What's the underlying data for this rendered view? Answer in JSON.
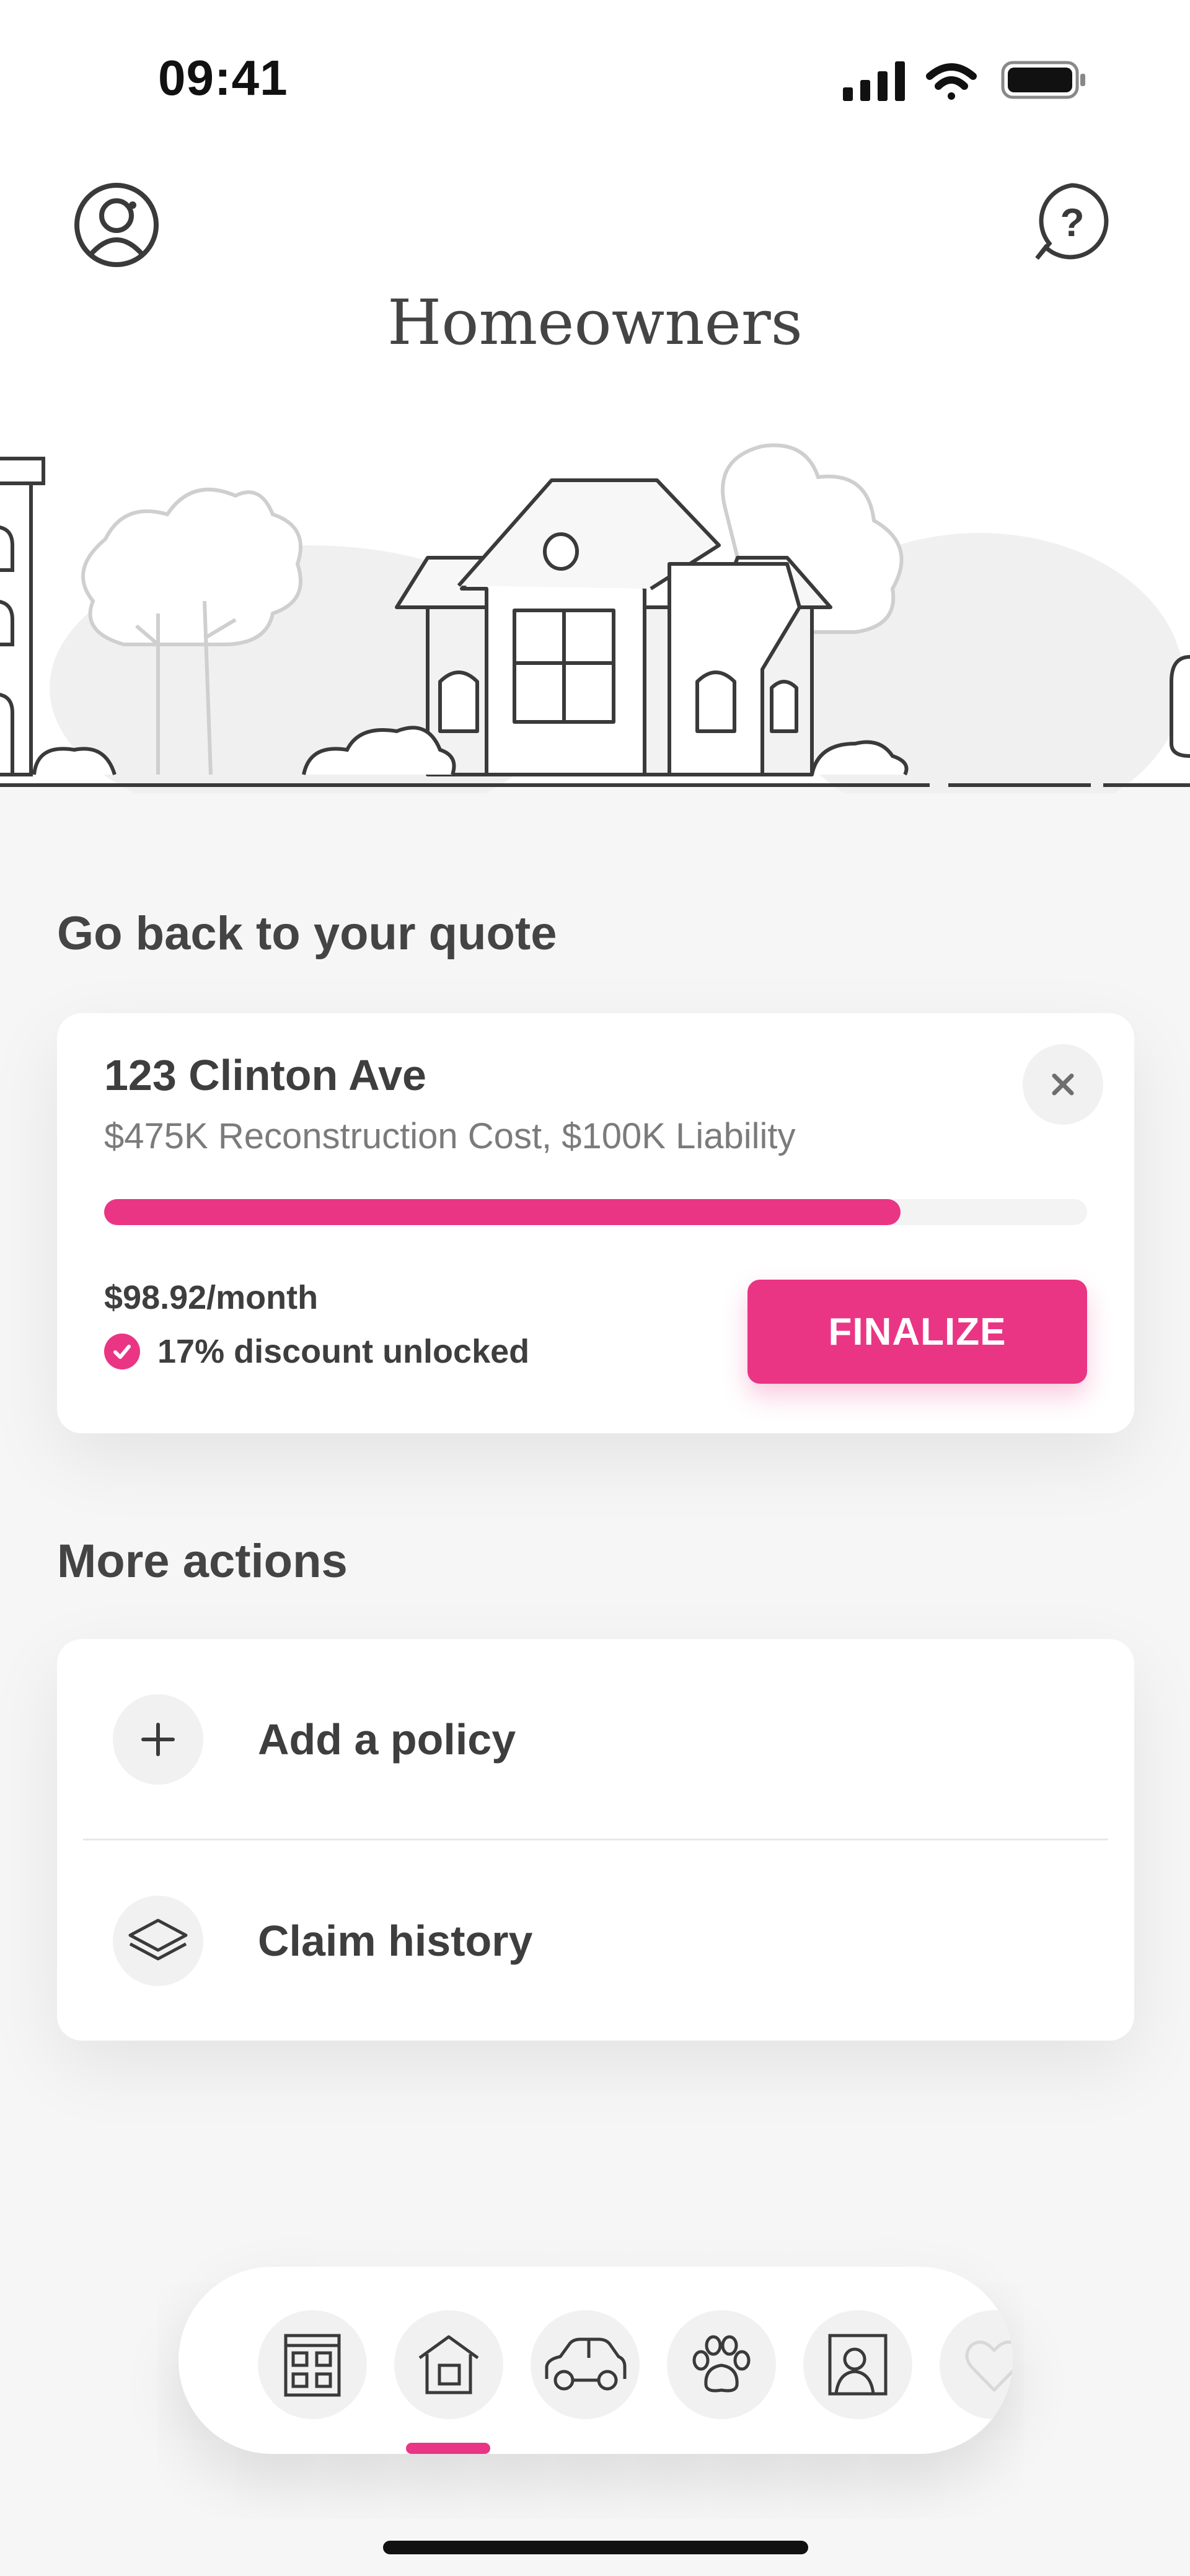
{
  "status_bar": {
    "time": "09:41"
  },
  "header": {
    "title": "Homeowners"
  },
  "quote_section": {
    "heading": "Go back to your quote",
    "address": "123 Clinton Ave",
    "details": "$475K Reconstruction Cost, $100K Liability",
    "progress_fraction": 0.81,
    "price": "$98.92/month",
    "discount": "17% discount unlocked",
    "finalize_label": "FINALIZE",
    "accent_color": "#ea3585"
  },
  "more_actions": {
    "heading": "More actions",
    "items": [
      {
        "label": "Add a policy",
        "icon": "plus-icon"
      },
      {
        "label": "Claim history",
        "icon": "layers-icon"
      }
    ]
  },
  "tab_bar": {
    "tabs": [
      {
        "icon": "apartment-icon"
      },
      {
        "icon": "home-icon",
        "active": true
      },
      {
        "icon": "car-icon"
      },
      {
        "icon": "paw-icon"
      },
      {
        "icon": "portrait-icon"
      },
      {
        "icon": "heart-icon"
      }
    ]
  }
}
